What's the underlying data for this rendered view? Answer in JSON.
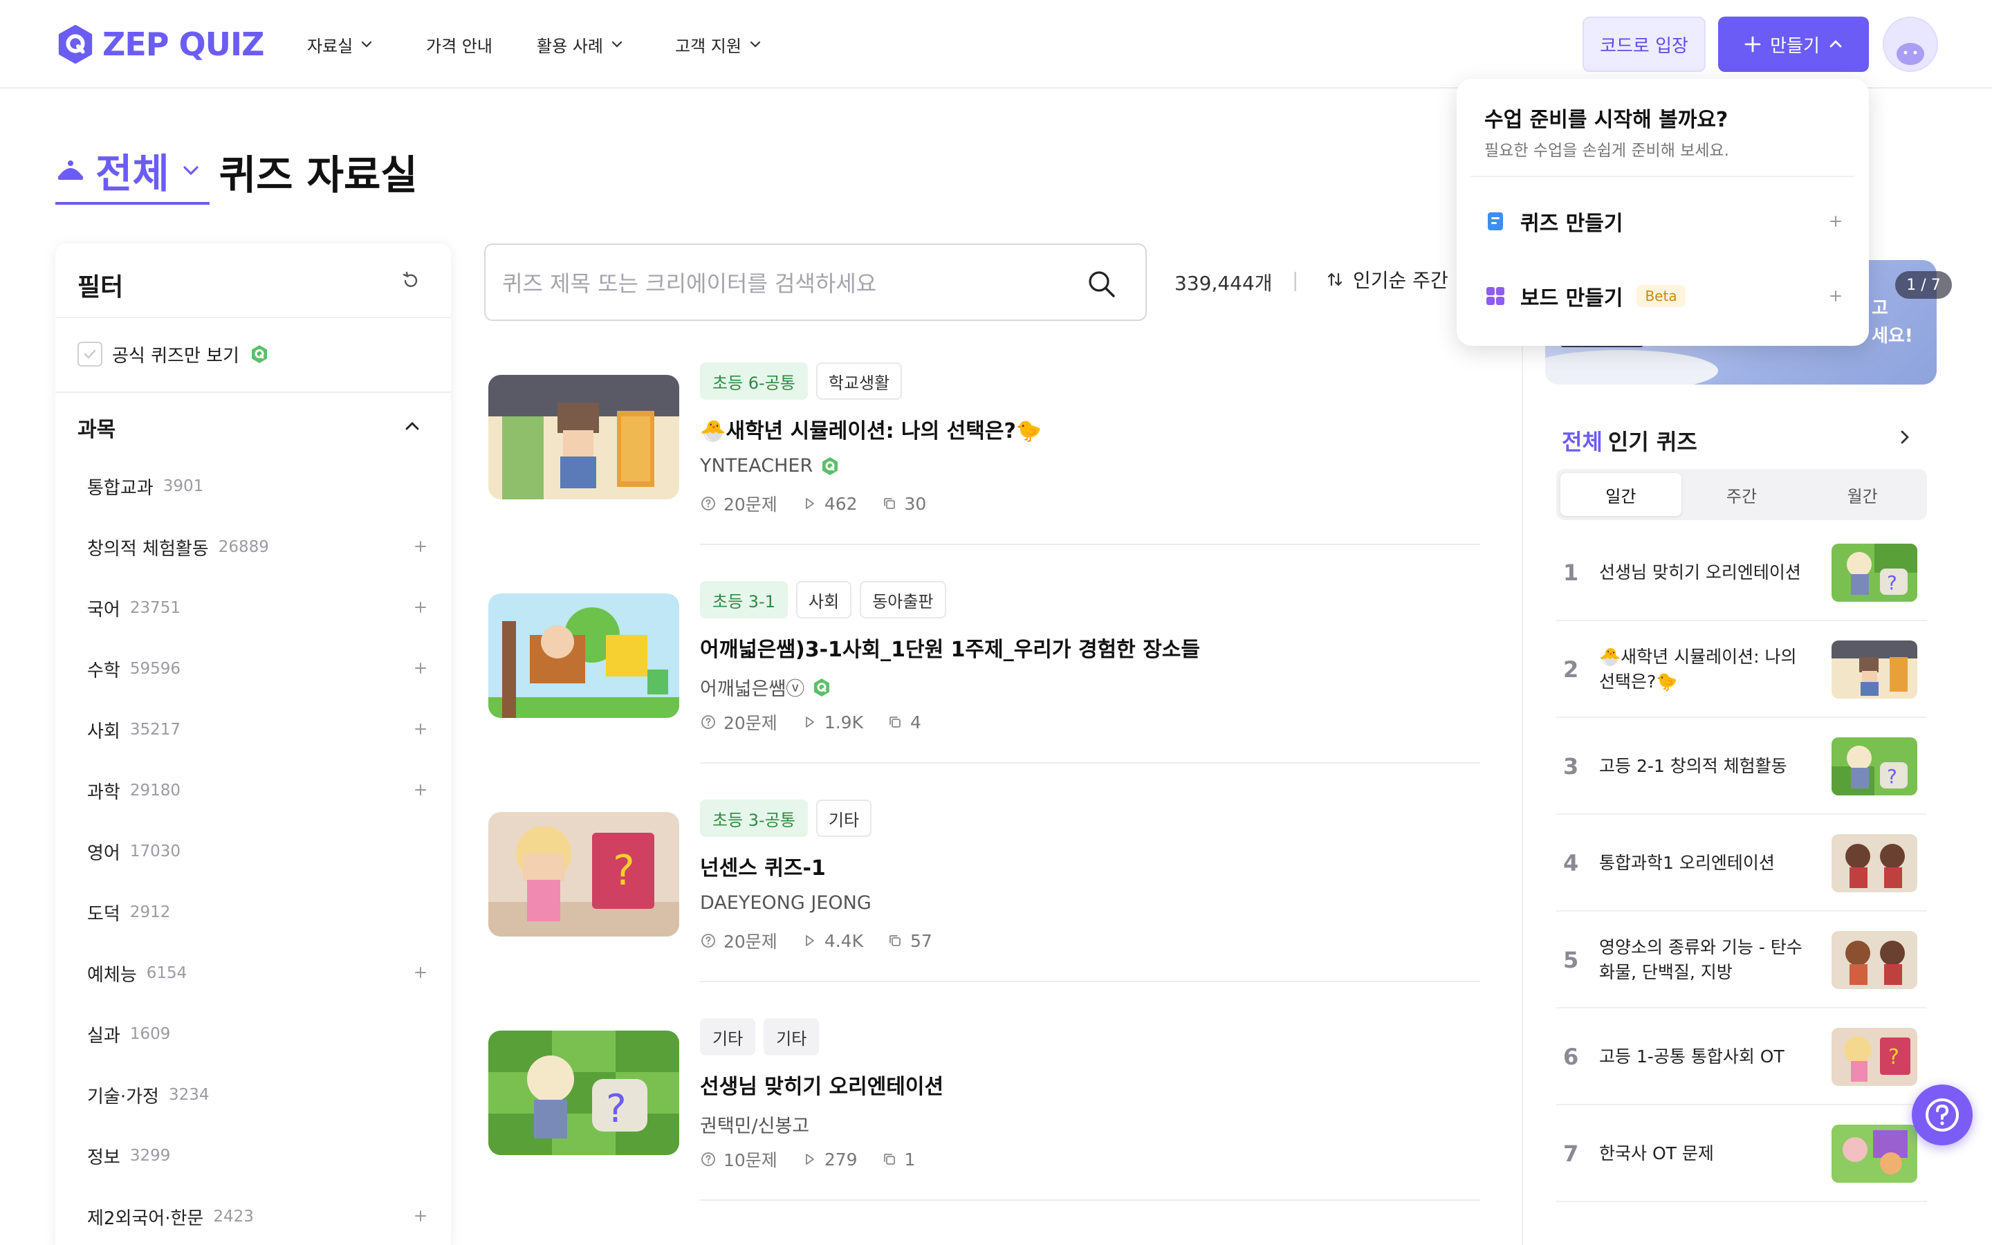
{
  "header": {
    "logo_text": "ZEP QUIZ",
    "nav": [
      {
        "label": "자료실",
        "has_chevron": true
      },
      {
        "label": "가격 안내",
        "has_chevron": false
      },
      {
        "label": "활용 사례",
        "has_chevron": true
      },
      {
        "label": "고객 지원",
        "has_chevron": true
      }
    ],
    "code_entry_label": "코드로 입장",
    "make_label": "만들기"
  },
  "page": {
    "category": "전체",
    "title": "퀴즈 자료실"
  },
  "filter": {
    "title": "필터",
    "official_only_label": "공식 퀴즈만 보기",
    "subject_title": "과목",
    "subjects": [
      {
        "name": "통합교과",
        "count": "3901",
        "expandable": false
      },
      {
        "name": "창의적 체험활동",
        "count": "26889",
        "expandable": true
      },
      {
        "name": "국어",
        "count": "23751",
        "expandable": true
      },
      {
        "name": "수학",
        "count": "59596",
        "expandable": true
      },
      {
        "name": "사회",
        "count": "35217",
        "expandable": true
      },
      {
        "name": "과학",
        "count": "29180",
        "expandable": true
      },
      {
        "name": "영어",
        "count": "17030",
        "expandable": false
      },
      {
        "name": "도덕",
        "count": "2912",
        "expandable": false
      },
      {
        "name": "예체능",
        "count": "6154",
        "expandable": true
      },
      {
        "name": "실과",
        "count": "1609",
        "expandable": false
      },
      {
        "name": "기술·가정",
        "count": "3234",
        "expandable": false
      },
      {
        "name": "정보",
        "count": "3299",
        "expandable": false
      },
      {
        "name": "제2외국어·한문",
        "count": "2423",
        "expandable": true
      }
    ]
  },
  "search": {
    "placeholder": "퀴즈 제목 또는 크리에이터를 검색하세요",
    "result_count": "339,444개",
    "sort_label": "인기순 주간"
  },
  "quizzes": [
    {
      "tags": [
        "초등 6-공통",
        "학교생활"
      ],
      "title": "🐣새학년 시뮬레이션: 나의 선택은?🐤",
      "creator": "YNTEACHER",
      "verified": true,
      "questions": "20문제",
      "plays": "462",
      "copies": "30"
    },
    {
      "tags": [
        "초등 3-1",
        "사회",
        "동아출판"
      ],
      "title": "어깨넓은쌤)3-1사회_1단원 1주제_우리가 경험한 장소들",
      "creator": "어깨넓은쌤ⓥ",
      "verified": true,
      "questions": "20문제",
      "plays": "1.9K",
      "copies": "4"
    },
    {
      "tags": [
        "초등 3-공통",
        "기타"
      ],
      "title": "넌센스 퀴즈-1",
      "creator": "DAEYEONG JEONG",
      "verified": false,
      "questions": "20문제",
      "plays": "4.4K",
      "copies": "57"
    },
    {
      "tags": [
        "기타",
        "기타"
      ],
      "title": "선생님 맞히기 오리엔테이션",
      "creator": "권택민/신봉고",
      "verified": false,
      "questions": "10문제",
      "plays": "279",
      "copies": "1"
    }
  ],
  "banner": {
    "page_indicator": "1 / 7",
    "text_line1": "고",
    "text_line2": "세요!"
  },
  "popular": {
    "accent": "전체",
    "title": "인기 퀴즈",
    "tabs": [
      "일간",
      "주간",
      "월간"
    ],
    "active_tab": "일간",
    "items": [
      {
        "rank": "1",
        "title": "선생님 맞히기 오리엔테이션"
      },
      {
        "rank": "2",
        "title": "🐣새학년 시뮬레이션: 나의 선택은?🐤"
      },
      {
        "rank": "3",
        "title": "고등 2-1 창의적 체험활동"
      },
      {
        "rank": "4",
        "title": "통합과학1 오리엔테이션"
      },
      {
        "rank": "5",
        "title": "영양소의 종류와 기능 - 탄수화물, 단백질, 지방"
      },
      {
        "rank": "6",
        "title": "고등 1-공통 통합사회 OT"
      },
      {
        "rank": "7",
        "title": "한국사 OT 문제"
      }
    ]
  },
  "dropdown": {
    "title": "수업 준비를 시작해 볼까요?",
    "subtitle": "필요한 수업을 손쉽게 준비해 보세요.",
    "items": [
      {
        "label": "퀴즈 만들기",
        "badge": ""
      },
      {
        "label": "보드 만들기",
        "badge": "Beta"
      }
    ]
  },
  "colors": {
    "brand": "#6b5cf5",
    "grade_tag_bg": "#e6f6ea",
    "grade_tag_text": "#2f8b45",
    "verified_badge": "#5bbf6a"
  }
}
